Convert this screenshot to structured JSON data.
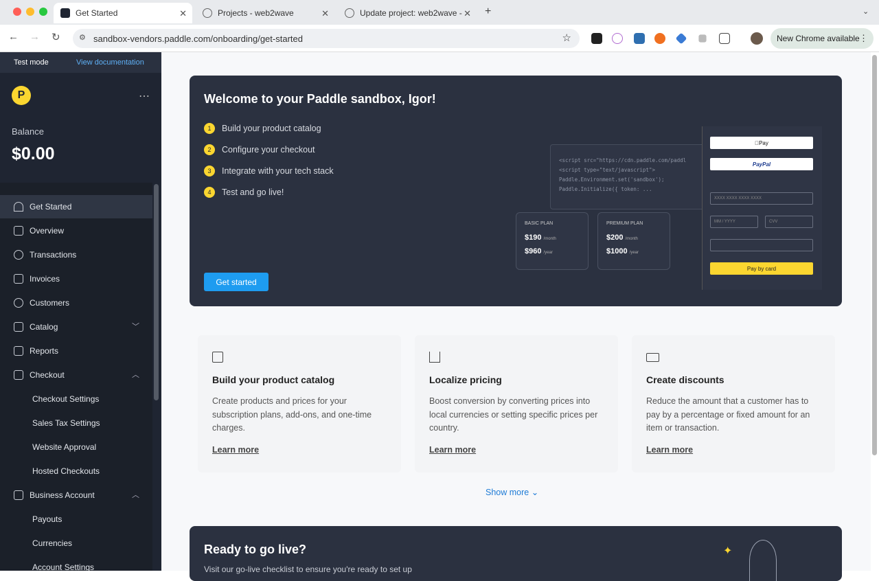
{
  "browser": {
    "tabs": [
      {
        "title": "Get Started"
      },
      {
        "title": "Projects - web2wave"
      },
      {
        "title": "Update project: web2wave -"
      }
    ],
    "url": "sandbox-vendors.paddle.com/onboarding/get-started",
    "new_chrome": "New Chrome available"
  },
  "sidebar": {
    "test_mode": "Test mode",
    "view_docs": "View documentation",
    "logo_letter": "P",
    "balance_label": "Balance",
    "balance_value": "$0.00",
    "items": [
      {
        "label": "Get Started"
      },
      {
        "label": "Overview"
      },
      {
        "label": "Transactions"
      },
      {
        "label": "Invoices"
      },
      {
        "label": "Customers"
      },
      {
        "label": "Catalog"
      },
      {
        "label": "Reports"
      },
      {
        "label": "Checkout"
      },
      {
        "label": "Checkout Settings"
      },
      {
        "label": "Sales Tax Settings"
      },
      {
        "label": "Website Approval"
      },
      {
        "label": "Hosted Checkouts"
      },
      {
        "label": "Business Account"
      },
      {
        "label": "Payouts"
      },
      {
        "label": "Currencies"
      },
      {
        "label": "Account Settings"
      }
    ]
  },
  "hero": {
    "title": "Welcome to your Paddle sandbox, Igor!",
    "steps": [
      {
        "n": "1",
        "t": "Build your product catalog"
      },
      {
        "n": "2",
        "t": "Configure your checkout"
      },
      {
        "n": "3",
        "t": "Integrate with your tech stack"
      },
      {
        "n": "4",
        "t": "Test and go live!"
      }
    ],
    "button": "Get started",
    "code_lines": [
      "<script src=\"https://cdn.paddle.com/paddl",
      "<script type=\"text/javascript\">",
      "  Paddle.Environment.set('sandbox');",
      "  Paddle.Initialize({ token: ..."
    ],
    "plans": [
      {
        "name": "BASIC PLAN",
        "p1": "$190",
        "u1": "/month",
        "p2": "$960",
        "u2": "/year"
      },
      {
        "name": "PREMIUM PLAN",
        "p1": "$200",
        "u1": "/month",
        "p2": "$1000",
        "u2": "/year"
      }
    ],
    "pay": {
      "apple": "Pay",
      "paypal": "PayPal",
      "card_ph": "XXXX XXXX XXXX XXXX",
      "mm": "MM / YYYY",
      "cvv": "CVV",
      "pay_btn": "Pay by card"
    }
  },
  "cards": [
    {
      "title": "Build your product catalog",
      "desc": "Create products and prices for your subscription plans, add-ons, and one-time charges.",
      "link": "Learn more"
    },
    {
      "title": "Localize pricing",
      "desc": "Boost conversion by converting prices into local currencies or setting specific prices per country.",
      "link": "Learn more"
    },
    {
      "title": "Create discounts",
      "desc": "Reduce the amount that a customer has to pay by a percentage or fixed amount for an item or transaction.",
      "link": "Learn more"
    }
  ],
  "show_more": "Show more",
  "golive": {
    "title": "Ready to go live?",
    "desc": "Visit our go-live checklist to ensure you're ready to set up"
  }
}
